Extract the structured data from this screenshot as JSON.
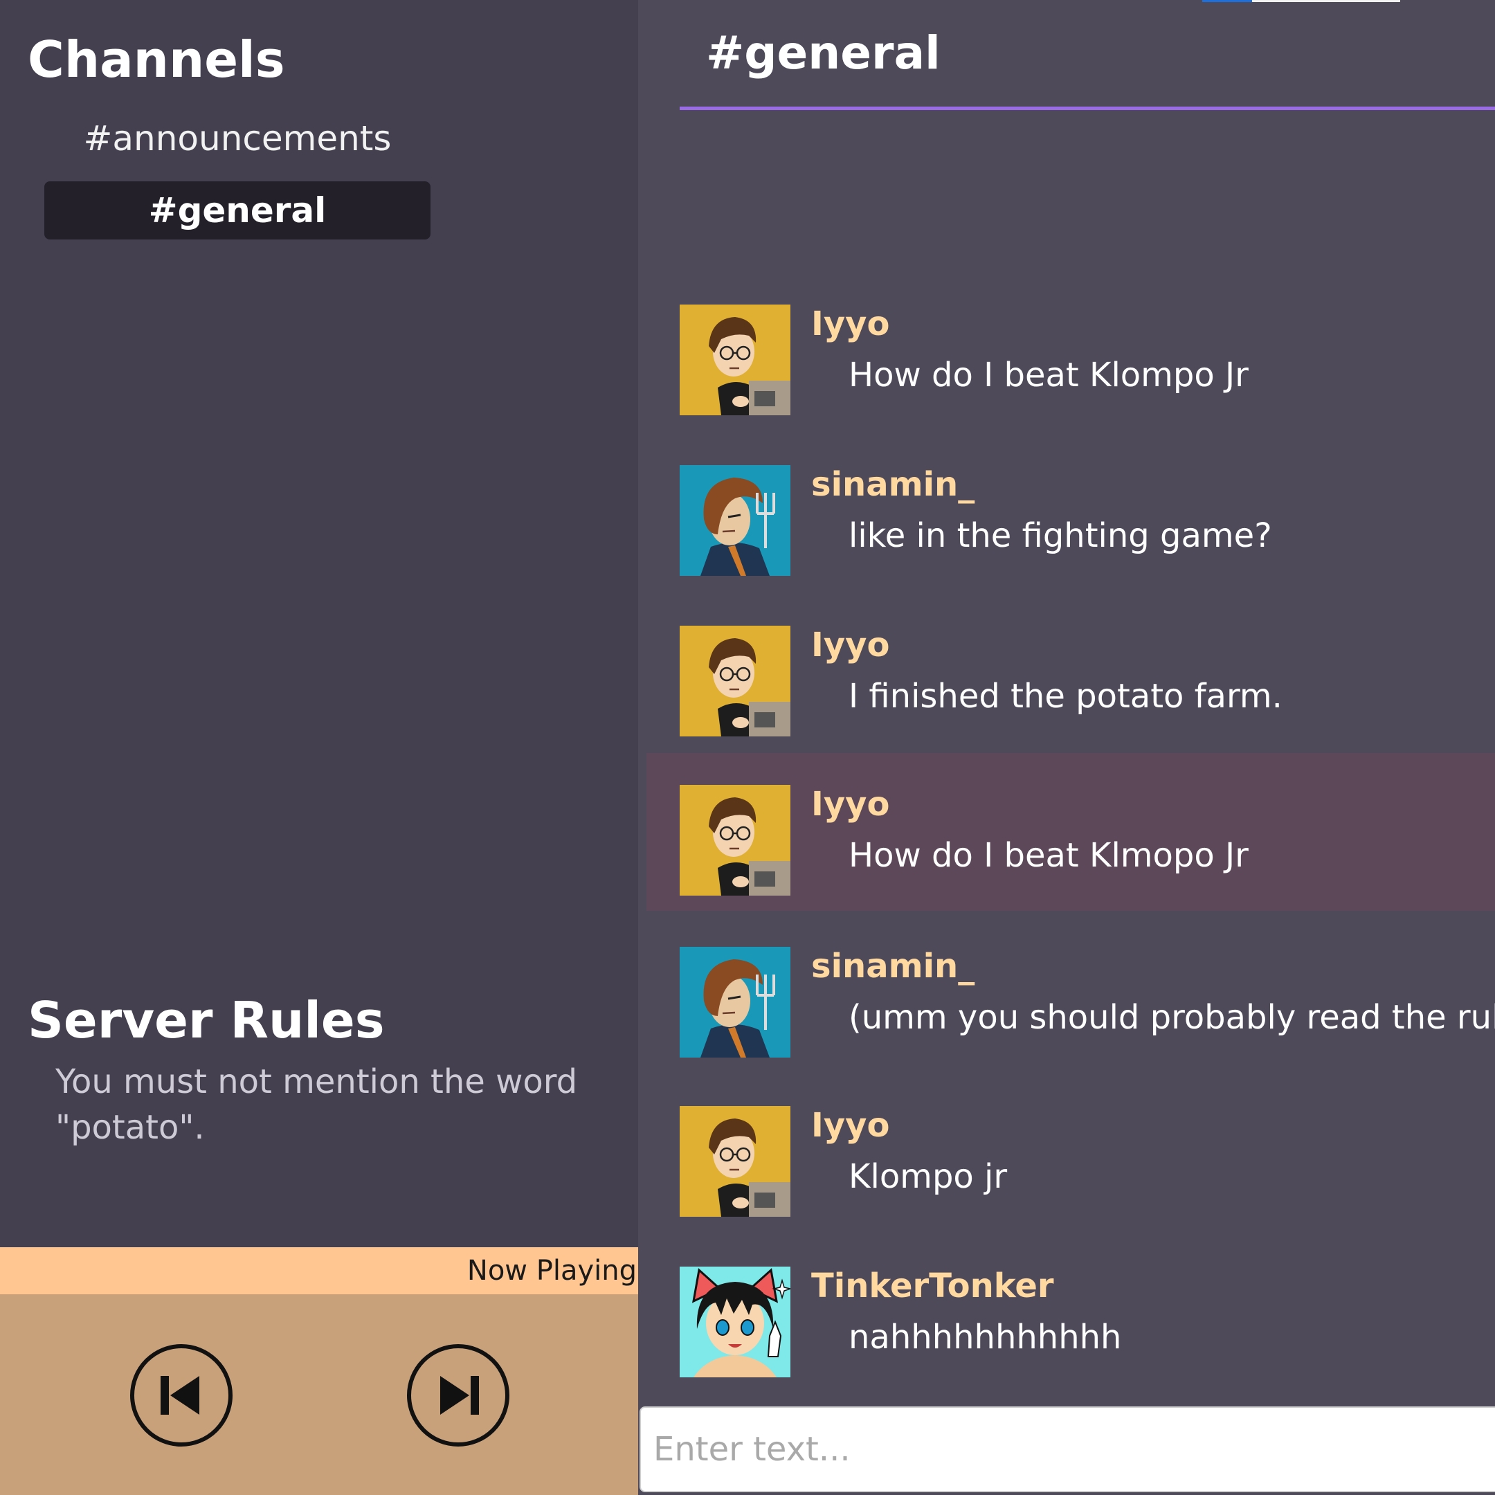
{
  "sidebar": {
    "channels_title": "Channels",
    "channels": [
      {
        "label": "#announcements",
        "active": false
      },
      {
        "label": "#general",
        "active": true
      }
    ],
    "rules_title": "Server Rules",
    "rules_text": "You must not mention the word \"potato\"."
  },
  "player": {
    "now_playing_label": "Now Playing",
    "prev_icon": "skip-previous-icon",
    "next_icon": "skip-next-icon"
  },
  "chat": {
    "title": "#general",
    "messages": [
      {
        "user": "Iyyo",
        "text": "How do I beat Klompo Jr",
        "avatar": "glasses-guy-avatar"
      },
      {
        "user": "sinamin_",
        "text": "like in the fighting game?",
        "avatar": "pitchfork-guy-avatar"
      },
      {
        "user": "Iyyo",
        "text": "I finished the potato farm.",
        "avatar": "glasses-guy-avatar"
      },
      {
        "user": "Iyyo",
        "text": "How do I beat Klmopo Jr",
        "avatar": "glasses-guy-avatar",
        "highlighted": true
      },
      {
        "user": "sinamin_",
        "text": "(umm you should probably read the rules",
        "avatar": "pitchfork-guy-avatar"
      },
      {
        "user": "Iyyo",
        "text": "Klompo jr",
        "avatar": "glasses-guy-avatar"
      },
      {
        "user": "TinkerTonker",
        "text": "nahhhhhhhhhhh",
        "avatar": "cat-ear-girl-avatar"
      }
    ],
    "input_placeholder": "Enter text..."
  },
  "colors": {
    "sidebar_bg": "#45404f",
    "chat_bg": "#4f4a5a",
    "accent_underline": "#9a6ce6",
    "username": "#ffd9a0",
    "highlight_row": "#5d4859",
    "now_playing_bar": "#ffc691",
    "player_bg": "#c8a17a"
  }
}
